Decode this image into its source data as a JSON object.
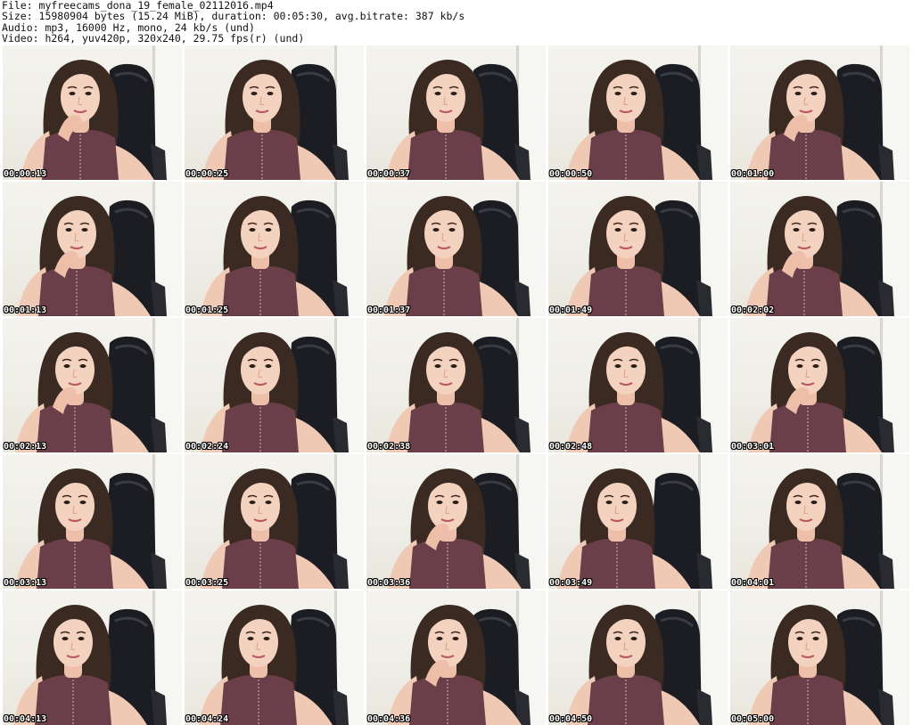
{
  "header": {
    "file_line": "File: myfreecams_dona_19_female_02112016.mp4",
    "size_line": "Size: 15980904 bytes (15.24 MiB), duration: 00:05:30, avg.bitrate: 387 kb/s",
    "audio_line": "Audio: mp3, 16000 Hz, mono, 24 kb/s (und)",
    "video_line": "Video: h264, yuv420p, 320x240, 29.75 fps(r) (und)"
  },
  "thumbnails": [
    {
      "timestamp": "00:00:13"
    },
    {
      "timestamp": "00:00:25"
    },
    {
      "timestamp": "00:00:37"
    },
    {
      "timestamp": "00:00:50"
    },
    {
      "timestamp": "00:01:00"
    },
    {
      "timestamp": "00:01:13"
    },
    {
      "timestamp": "00:01:25"
    },
    {
      "timestamp": "00:01:37"
    },
    {
      "timestamp": "00:01:49"
    },
    {
      "timestamp": "00:02:02"
    },
    {
      "timestamp": "00:02:13"
    },
    {
      "timestamp": "00:02:24"
    },
    {
      "timestamp": "00:02:38"
    },
    {
      "timestamp": "00:02:48"
    },
    {
      "timestamp": "00:03:01"
    },
    {
      "timestamp": "00:03:13"
    },
    {
      "timestamp": "00:03:25"
    },
    {
      "timestamp": "00:03:36"
    },
    {
      "timestamp": "00:03:49"
    },
    {
      "timestamp": "00:04:01"
    },
    {
      "timestamp": "00:04:13"
    },
    {
      "timestamp": "00:04:24"
    },
    {
      "timestamp": "00:04:36"
    },
    {
      "timestamp": "00:04:50"
    },
    {
      "timestamp": "00:05:00"
    }
  ],
  "colors": {
    "background": "#ffffff",
    "wall": "#efeee7",
    "chair": "#1c1d22",
    "hair": "#3a2a22",
    "skin": "#f0c9b5",
    "top": "#6a3f4a",
    "timestamp_text": "#ffffff",
    "timestamp_outline": "#000000"
  }
}
